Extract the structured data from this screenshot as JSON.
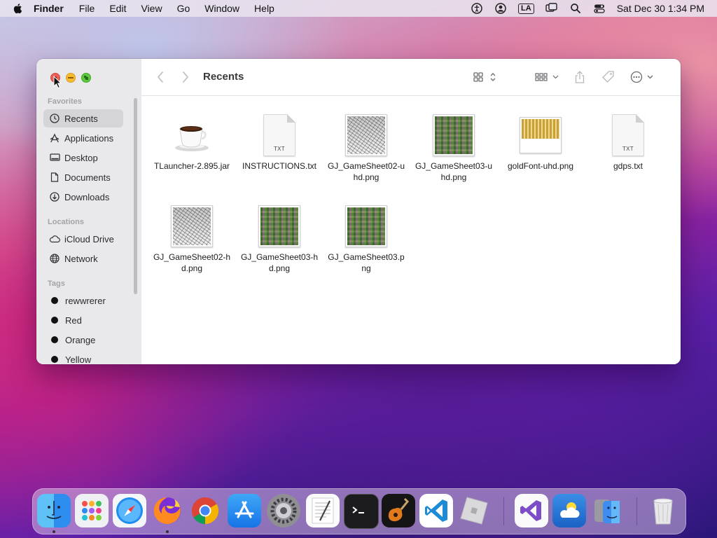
{
  "menubar": {
    "app_name": "Finder",
    "items": [
      "File",
      "Edit",
      "View",
      "Go",
      "Window",
      "Help"
    ],
    "input_source": "LA",
    "clock": "Sat Dec 30  1:34 PM"
  },
  "window": {
    "title": "Recents",
    "sidebar": {
      "favorites_label": "Favorites",
      "favorites": [
        {
          "label": "Recents",
          "icon": "clock-icon"
        },
        {
          "label": "Applications",
          "icon": "applications-icon"
        },
        {
          "label": "Desktop",
          "icon": "desktop-icon"
        },
        {
          "label": "Documents",
          "icon": "document-icon"
        },
        {
          "label": "Downloads",
          "icon": "download-icon"
        }
      ],
      "locations_label": "Locations",
      "locations": [
        {
          "label": "iCloud Drive",
          "icon": "cloud-icon"
        },
        {
          "label": "Network",
          "icon": "network-icon"
        }
      ],
      "tags_label": "Tags",
      "tags": [
        "rewwrerer",
        "Red",
        "Orange",
        "Yellow"
      ]
    },
    "files": [
      {
        "name": "TLauncher-2.895.jar",
        "kind": "jar"
      },
      {
        "name": "INSTRUCTIONS.txt",
        "kind": "txt"
      },
      {
        "name": "GJ_GameSheet02-uhd.png",
        "kind": "gray"
      },
      {
        "name": "GJ_GameSheet03-uhd.png",
        "kind": "color"
      },
      {
        "name": "goldFont-uhd.png",
        "kind": "gold"
      },
      {
        "name": "gdps.txt",
        "kind": "txt"
      },
      {
        "name": "GJ_GameSheet02-hd.png",
        "kind": "gray"
      },
      {
        "name": "GJ_GameSheet03-hd.png",
        "kind": "color"
      },
      {
        "name": "GJ_GameSheet03.png",
        "kind": "color"
      }
    ],
    "txt_badge": "TXT"
  },
  "dock": {
    "apps": [
      {
        "name": "finder-icon",
        "running": true
      },
      {
        "name": "launchpad-icon",
        "running": false
      },
      {
        "name": "safari-icon",
        "running": false
      },
      {
        "name": "firefox-icon",
        "running": true
      },
      {
        "name": "chrome-icon",
        "running": false
      },
      {
        "name": "app-store-icon",
        "running": false
      },
      {
        "name": "system-preferences-icon",
        "running": false
      },
      {
        "name": "textedit-icon",
        "running": false
      },
      {
        "name": "terminal-icon",
        "running": false
      },
      {
        "name": "garageband-icon",
        "running": false
      },
      {
        "name": "vscode-icon",
        "running": false
      },
      {
        "name": "roblox-icon",
        "running": false
      },
      {
        "name": "visual-studio-icon",
        "running": false
      },
      {
        "name": "weather-icon",
        "running": false
      },
      {
        "name": "finder-migration-icon",
        "running": false
      },
      {
        "name": "trash-icon",
        "running": false
      }
    ]
  }
}
